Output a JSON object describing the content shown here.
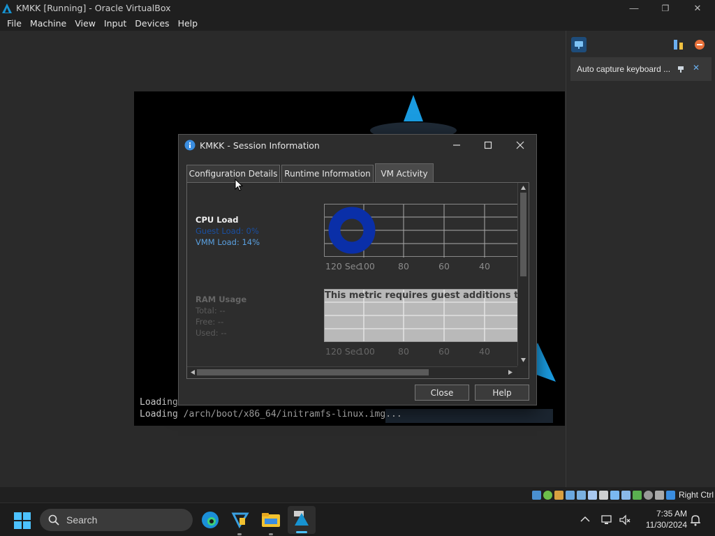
{
  "window": {
    "title": "KMKK [Running] - Oracle VirtualBox",
    "minimize": "—",
    "restore": "❐",
    "close": "✕"
  },
  "menu": [
    "File",
    "Machine",
    "View",
    "Input",
    "Devices",
    "Help"
  ],
  "console": {
    "line1": "Loading",
    "line2": "Loading /arch/boot/x86_64/initramfs-linux.img..."
  },
  "notification": {
    "text": "Auto capture keyboard ...",
    "close": "✕"
  },
  "dialog": {
    "title": "KMKK - Session Information",
    "tabs": [
      "Configuration Details",
      "Runtime Information",
      "VM Activity"
    ],
    "active_tab": 2,
    "cpu": {
      "heading": "CPU Load",
      "guest": "Guest Load: 0%",
      "vmm": "VMM Load: 14%"
    },
    "ram": {
      "heading": "RAM Usage",
      "total": "Total: --",
      "free": "Free: --",
      "used": "Used: --",
      "notice": "This metric requires guest additions to wo"
    },
    "axis_labels": [
      "120 Sec",
      "100",
      "80",
      "60",
      "40"
    ],
    "buttons": {
      "close": "Close",
      "help": "Help"
    }
  },
  "statusbar": {
    "host_key": "Right Ctrl"
  },
  "taskbar": {
    "search": "Search",
    "time": "7:35 AM",
    "date": "11/30/2024"
  },
  "colors": {
    "cpu_ring": "#0a2fa8",
    "accent_blue": "#5aa0e0",
    "arch_blue": "#1793d1"
  }
}
